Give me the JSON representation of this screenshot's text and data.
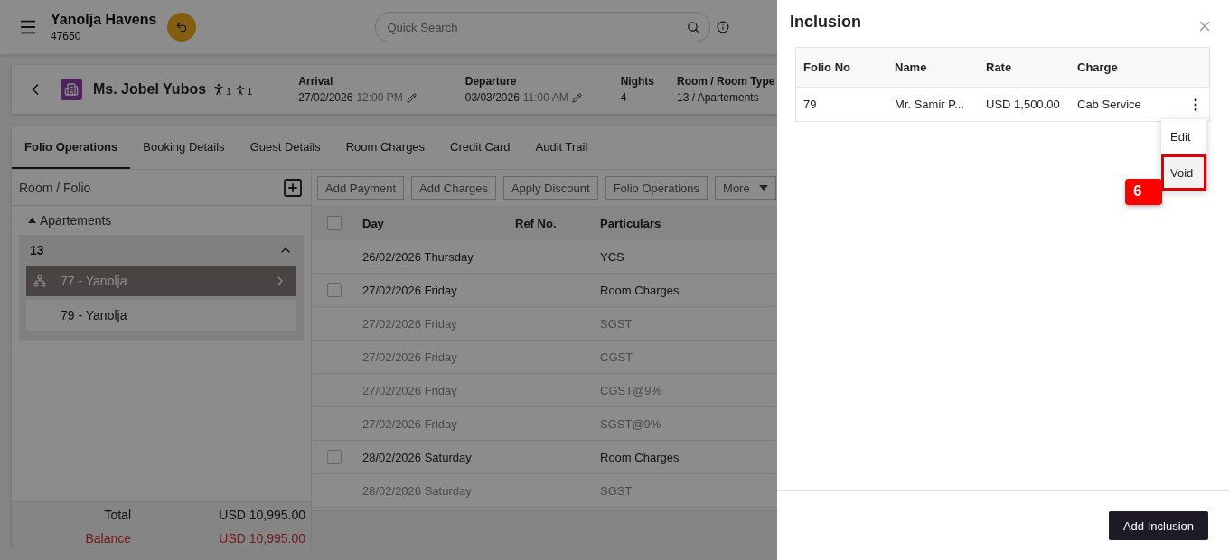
{
  "header": {
    "hotel": "Yanolja Havens",
    "code": "47650",
    "search": {
      "placeholder": "Quick Search"
    }
  },
  "guest": {
    "name": "Ms. Jobel Yubos",
    "adults": "1",
    "children": "1",
    "arrival": {
      "label": "Arrival",
      "date": "27/02/2026",
      "time": "12:00 PM"
    },
    "departure": {
      "label": "Departure",
      "date": "03/03/2026",
      "time": "11:00 AM"
    },
    "nights": {
      "label": "Nights",
      "value": "4"
    },
    "room": {
      "label": "Room / Room Type",
      "value": "13 / Apartements"
    }
  },
  "tabs": [
    {
      "label": "Folio Operations",
      "selected": true
    },
    {
      "label": "Booking Details",
      "selected": false
    },
    {
      "label": "Guest Details",
      "selected": false
    },
    {
      "label": "Room Charges",
      "selected": false
    },
    {
      "label": "Credit Card",
      "selected": false
    },
    {
      "label": "Audit Trail",
      "selected": false
    }
  ],
  "folio_panel": {
    "title": "Room / Folio",
    "group": {
      "label": "Apartements",
      "expanded": true
    },
    "room": {
      "number": "13",
      "expanded": true,
      "folios": [
        {
          "label": "77 - Yanolja",
          "selected": true
        },
        {
          "label": "79 - Yanolja",
          "selected": false
        }
      ]
    },
    "totals": [
      {
        "label": "Total",
        "value": "USD 10,995.00",
        "kind": "total"
      },
      {
        "label": "Balance",
        "value": "USD 10,995.00",
        "kind": "balance"
      }
    ]
  },
  "toolbar": [
    {
      "label": "Add Payment",
      "kind": "button"
    },
    {
      "label": "Add Charges",
      "kind": "button"
    },
    {
      "label": "Apply Discount",
      "kind": "button"
    },
    {
      "label": "Folio Operations",
      "kind": "button"
    },
    {
      "label": "More",
      "kind": "dropdown"
    }
  ],
  "ledger": {
    "columns": [
      "Day",
      "Ref No.",
      "Particulars"
    ],
    "header_checked": false,
    "rows": [
      {
        "day": "26/02/2026 Thursday",
        "particulars": "YCS",
        "kind": "voided"
      },
      {
        "day": "27/02/2026 Friday",
        "particulars": "Room Charges",
        "kind": "charge",
        "checked": false
      },
      {
        "day": "27/02/2026 Friday",
        "particulars": "SGST",
        "kind": "tax"
      },
      {
        "day": "27/02/2026 Friday",
        "particulars": "CGST",
        "kind": "tax"
      },
      {
        "day": "27/02/2026 Friday",
        "particulars": "CGST@9%",
        "kind": "tax"
      },
      {
        "day": "27/02/2026 Friday",
        "particulars": "SGST@9%",
        "kind": "tax"
      },
      {
        "day": "28/02/2026 Saturday",
        "particulars": "Room Charges",
        "kind": "charge",
        "checked": false
      },
      {
        "day": "28/02/2026 Saturday",
        "particulars": "SGST",
        "kind": "tax"
      }
    ]
  },
  "drawer": {
    "title": "Inclusion",
    "columns": [
      "Folio No",
      "Name",
      "Rate",
      "Charge"
    ],
    "rows": [
      {
        "folio_no": "79",
        "name": "Mr. Samir P...",
        "rate": "USD 1,500.00",
        "charge": "Cab Service"
      }
    ],
    "menu": [
      {
        "label": "Edit",
        "highlighted": false
      },
      {
        "label": "Void",
        "highlighted": true
      }
    ],
    "step_badge": "6",
    "primary_button": "Add Inclusion"
  }
}
